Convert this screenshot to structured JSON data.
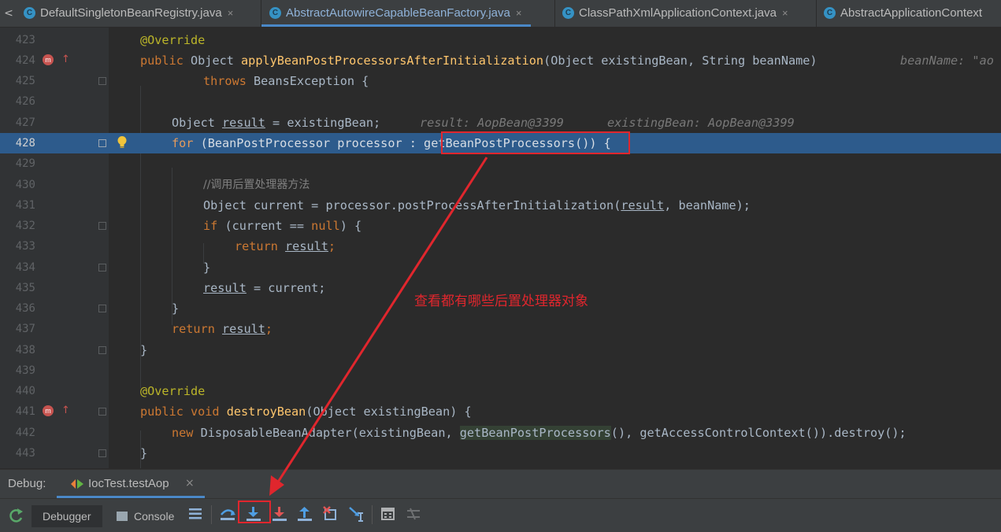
{
  "tabs": [
    {
      "label": "DefaultSingletonBeanRegistry.java",
      "close": "×",
      "active": false,
      "icon": "class-icon"
    },
    {
      "label": "AbstractAutowireCapableBeanFactory.java",
      "close": "×",
      "active": true,
      "icon": "class-icon"
    },
    {
      "label": "ClassPathXmlApplicationContext.java",
      "close": "×",
      "active": false,
      "icon": "class-icon"
    },
    {
      "label": "AbstractApplicationContext",
      "close": "",
      "active": false,
      "icon": "class-icon"
    }
  ],
  "tab_nav_symbol": "<",
  "class_icon_letter": "C",
  "editor": {
    "current_line": "428",
    "lines": [
      {
        "n": "423"
      },
      {
        "n": "424"
      },
      {
        "n": "425"
      },
      {
        "n": "426"
      },
      {
        "n": "427"
      },
      {
        "n": "428"
      },
      {
        "n": "429"
      },
      {
        "n": "430"
      },
      {
        "n": "431"
      },
      {
        "n": "432"
      },
      {
        "n": "433"
      },
      {
        "n": "434"
      },
      {
        "n": "435"
      },
      {
        "n": "436"
      },
      {
        "n": "437"
      },
      {
        "n": "438"
      },
      {
        "n": "439"
      },
      {
        "n": "440"
      },
      {
        "n": "441"
      },
      {
        "n": "442"
      },
      {
        "n": "443"
      }
    ],
    "code": {
      "l423": "@Override",
      "l424_kw": "public",
      "l424_type": " Object ",
      "l424_fn": "applyBeanPostProcessorsAfterInitialization",
      "l424_params": "(Object existingBean, String beanName)",
      "l424_hint": "beanName: \"ao",
      "l425_kw": "throws",
      "l425_rest": " BeansException {",
      "l427_a": "Object ",
      "l427_var": "result",
      "l427_b": " = existingBean;",
      "l427_hint1": "result: AopBean@3399",
      "l427_hint2": "existingBean: AopBean@3399",
      "l428_kw": "for",
      "l428_a": " (BeanPostProcessor processor : ",
      "l428_call": "getBeanPostProcessors()",
      "l428_b": ") {",
      "l430": "//调用后置处理器方法",
      "l431_a": "Object current = processor.postProcessAfterInitialization(",
      "l431_var": "result",
      "l431_b": ", beanName);",
      "l432_kw": "if",
      "l432_a": " (current == ",
      "l432_null": "null",
      "l432_b": ") {",
      "l433_kw": "return",
      "l433_var": "result",
      "l433_b": ";",
      "l434": "}",
      "l435_var": "result",
      "l435_b": " = current;",
      "l436": "}",
      "l437_kw": "return",
      "l437_var": "result",
      "l437_b": ";",
      "l438": "}",
      "l440": "@Override",
      "l441_kw": "public void",
      "l441_fn": "destroyBean",
      "l441_rest": "(Object existingBean) {",
      "l442_kw": "new",
      "l442_a": " DisposableBeanAdapter(existingBean, ",
      "l442_call": "getBeanPostProcessors",
      "l442_b": "(), getAccessControlContext()).destroy();",
      "l443": "}"
    },
    "override_icon_letter": "m",
    "override_arrow": "↑"
  },
  "annotation": {
    "text": "查看都有哪些后置处理器对象",
    "color": "#e0262d"
  },
  "debug": {
    "label": "Debug:",
    "session": "IocTest.testAop",
    "session_close": "×",
    "tabs": [
      {
        "label": "Debugger",
        "selected": true
      },
      {
        "label": "Console",
        "selected": false
      }
    ],
    "toolbar": [
      "rerun-icon",
      "threads-menu-icon",
      "show-execution-point-icon",
      "step-over-icon",
      "step-into-icon",
      "force-step-into-icon",
      "step-out-icon",
      "drop-frame-icon",
      "run-to-cursor-icon",
      "evaluate-expression-icon",
      "trace-icon"
    ]
  }
}
